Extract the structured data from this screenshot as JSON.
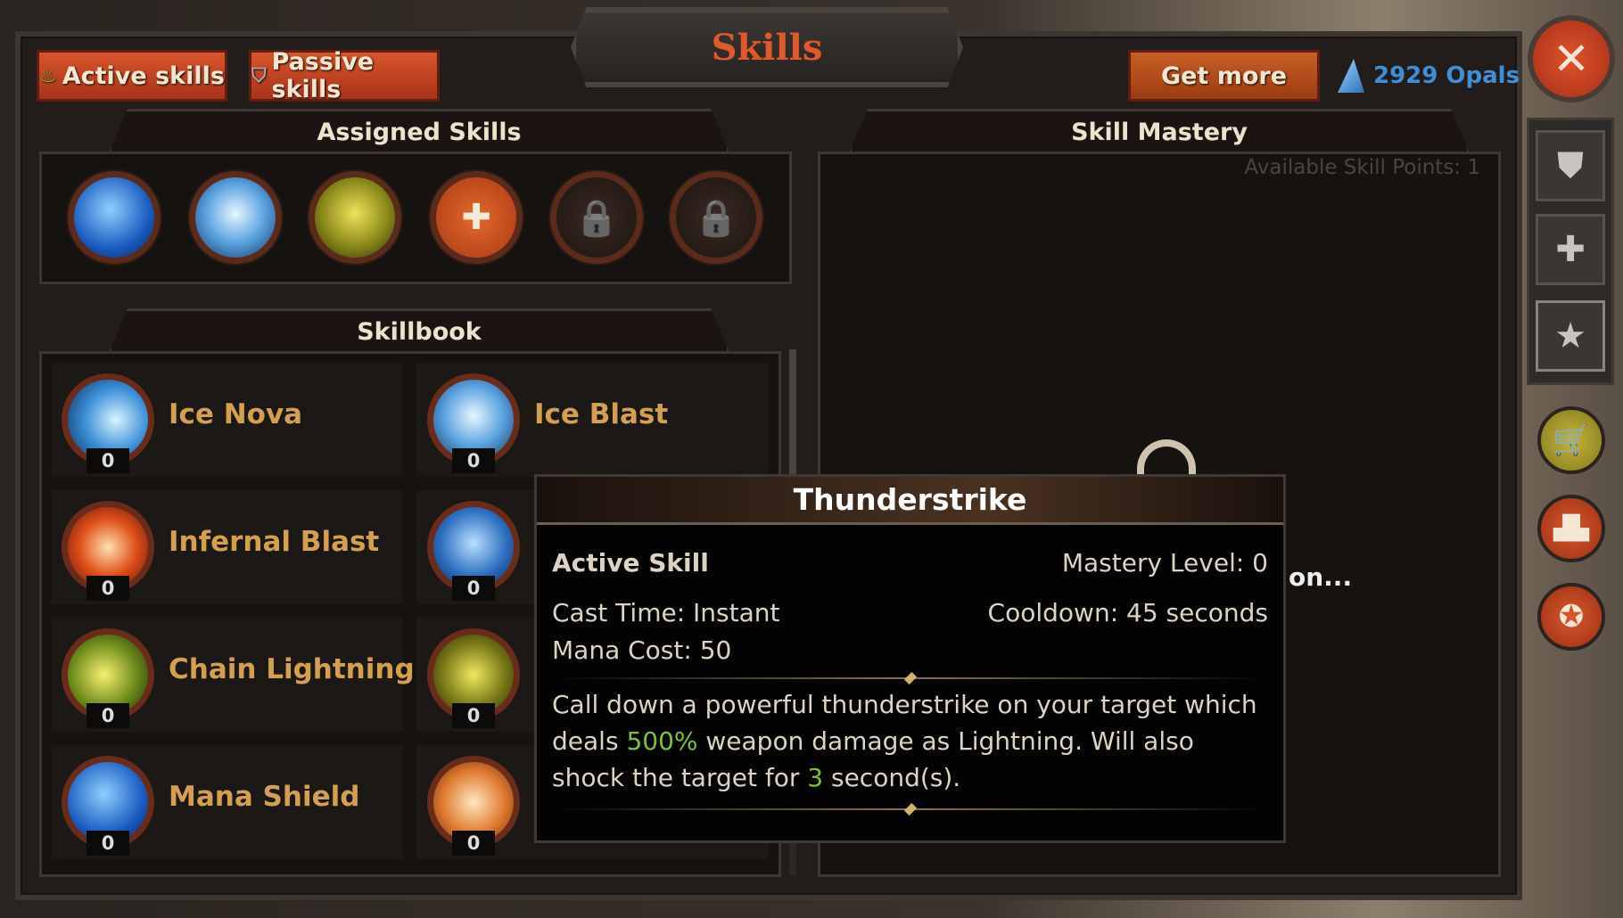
{
  "header": {
    "title": "Skills",
    "tabs": [
      {
        "label": "Active skills",
        "icon": "flame-icon"
      },
      {
        "label": "Passive skills",
        "icon": "shield-icon"
      }
    ],
    "get_more_label": "Get more",
    "currency": "2929 Opals",
    "close_icon": "close-icon"
  },
  "assigned": {
    "title": "Assigned Skills",
    "slots": [
      {
        "icon": "mana-shield-icon"
      },
      {
        "icon": "ice-blast-icon"
      },
      {
        "icon": "tornado-icon"
      },
      {
        "icon": "add-icon"
      },
      {
        "icon": "lock-icon"
      },
      {
        "icon": "lock-icon"
      }
    ]
  },
  "skillbook": {
    "title": "Skillbook",
    "skills": [
      {
        "name": "Ice Nova",
        "level": "0",
        "icon": "ice-nova-icon"
      },
      {
        "name": "Ice Blast",
        "level": "0",
        "icon": "ice-blast-icon"
      },
      {
        "name": "Infernal Blast",
        "level": "0",
        "icon": "infernal-blast-icon"
      },
      {
        "name": "",
        "level": "0",
        "icon": "ice-shard-icon"
      },
      {
        "name": "Chain Lightning",
        "level": "0",
        "icon": "chain-lightning-icon"
      },
      {
        "name": "",
        "level": "0",
        "icon": "thunderstrike-icon"
      },
      {
        "name": "Mana Shield",
        "level": "0",
        "icon": "mana-shield-icon"
      },
      {
        "name": "",
        "level": "0",
        "icon": "hexagram-icon"
      }
    ]
  },
  "mastery": {
    "title": "Skill Mastery",
    "available_points": "Available Skill Points: 1",
    "partial_text": "on..."
  },
  "tooltip": {
    "title": "Thunderstrike",
    "type": "Active Skill",
    "mastery_level": "Mastery Level: 0",
    "cast_time": "Cast Time: Instant",
    "cooldown": "Cooldown: 45 seconds",
    "mana_cost": "Mana Cost: 50",
    "desc_1": "Call down a powerful thunderstrike on your target which deals ",
    "desc_damage": "500%",
    "desc_2": " weapon damage as Lightning. Will also shock the target for ",
    "desc_duration": "3",
    "desc_3": " second(s)."
  },
  "sidebar": {
    "tabs": [
      {
        "icon": "armor-icon"
      },
      {
        "icon": "plus-icon"
      },
      {
        "icon": "star-icon"
      }
    ],
    "buttons": [
      {
        "icon": "cart-icon"
      },
      {
        "icon": "podium-icon"
      },
      {
        "icon": "medal-icon"
      }
    ]
  },
  "colors": {
    "accent": "#e0592b",
    "skill_name": "#d4a04f",
    "opals": "#3f8fd8",
    "highlight": "#7dc13a"
  }
}
